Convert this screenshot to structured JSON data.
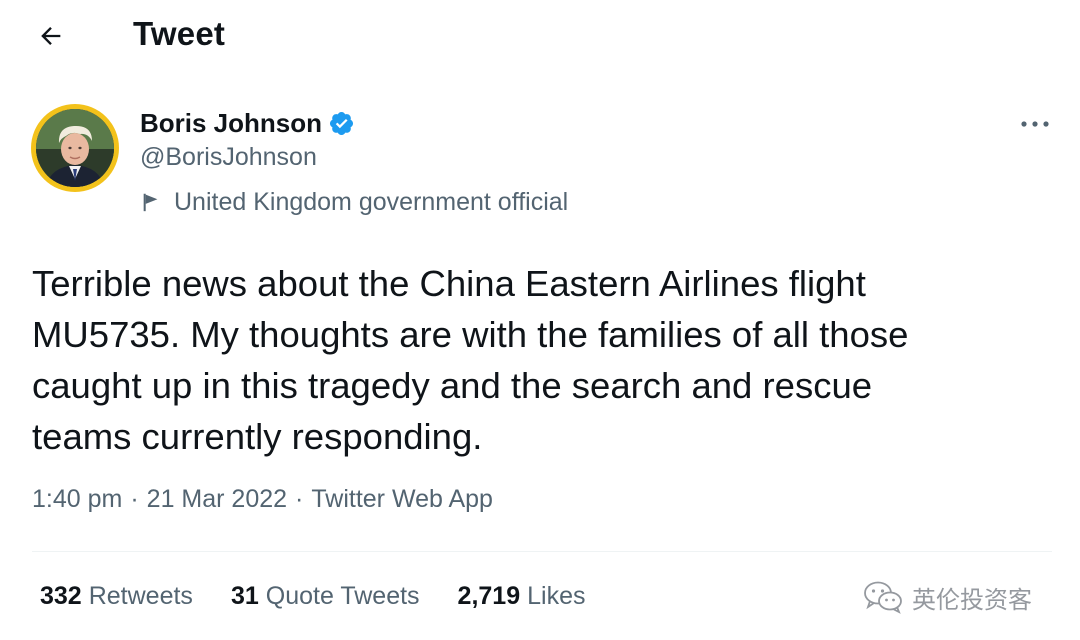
{
  "header": {
    "title": "Tweet",
    "back_icon": "arrow-left-icon"
  },
  "author": {
    "display_name": "Boris Johnson",
    "handle": "@BorisJohnson",
    "verified_icon": "verified-badge-icon",
    "label": "United Kingdom government official",
    "label_icon": "flag-icon",
    "avatar_ring_color": "#F3C21B"
  },
  "tweet": {
    "text": "Terrible news about the China Eastern Airlines flight\nMU5735. My thoughts are with the families of all those\ncaught up in this tragedy and the search and rescue\nteams currently responding.",
    "time": "1:40 pm",
    "date": "21 Mar 2022",
    "source": "Twitter Web App",
    "separator": "·"
  },
  "stats": {
    "retweets_count": "332",
    "retweets_label": "Retweets",
    "quotes_count": "31",
    "quotes_label": "Quote Tweets",
    "likes_count": "2,719",
    "likes_label": "Likes"
  },
  "more_icon": "more-horizontal-icon",
  "watermark": {
    "text": "英伦投资客",
    "icon": "wechat-icon"
  },
  "colors": {
    "text_primary": "#0F1419",
    "text_secondary": "#536471",
    "verified_blue": "#1D9BF0",
    "divider": "#EFF3F4"
  }
}
